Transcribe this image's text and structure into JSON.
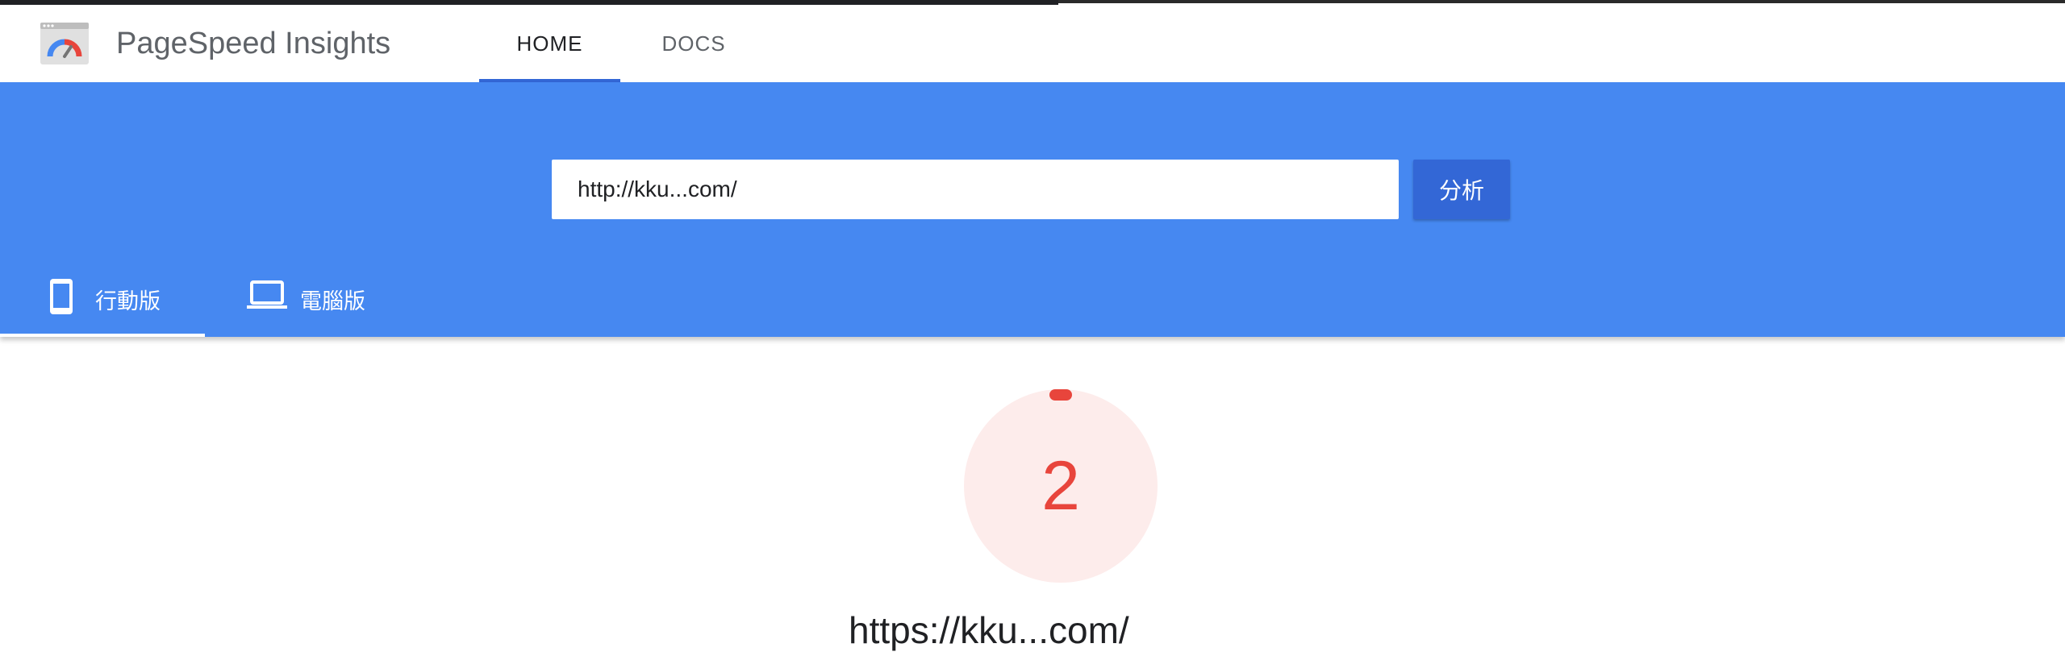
{
  "app": {
    "title": "PageSpeed Insights"
  },
  "nav": {
    "tabs": [
      {
        "label": "HOME",
        "active": true
      },
      {
        "label": "DOCS",
        "active": false
      }
    ]
  },
  "search": {
    "value": "http://kku...com/",
    "button_label": "分析"
  },
  "device_tabs": [
    {
      "label": "行動版",
      "icon": "smartphone-icon",
      "active": true
    },
    {
      "label": "電腦版",
      "icon": "laptop-icon",
      "active": false
    }
  ],
  "result": {
    "score": "2",
    "url": "https://kku...com/"
  },
  "colors": {
    "accent_blue": "#4688f1",
    "button_blue": "#3367d6",
    "score_red": "#e8453c",
    "score_bg": "#fdeceb"
  }
}
